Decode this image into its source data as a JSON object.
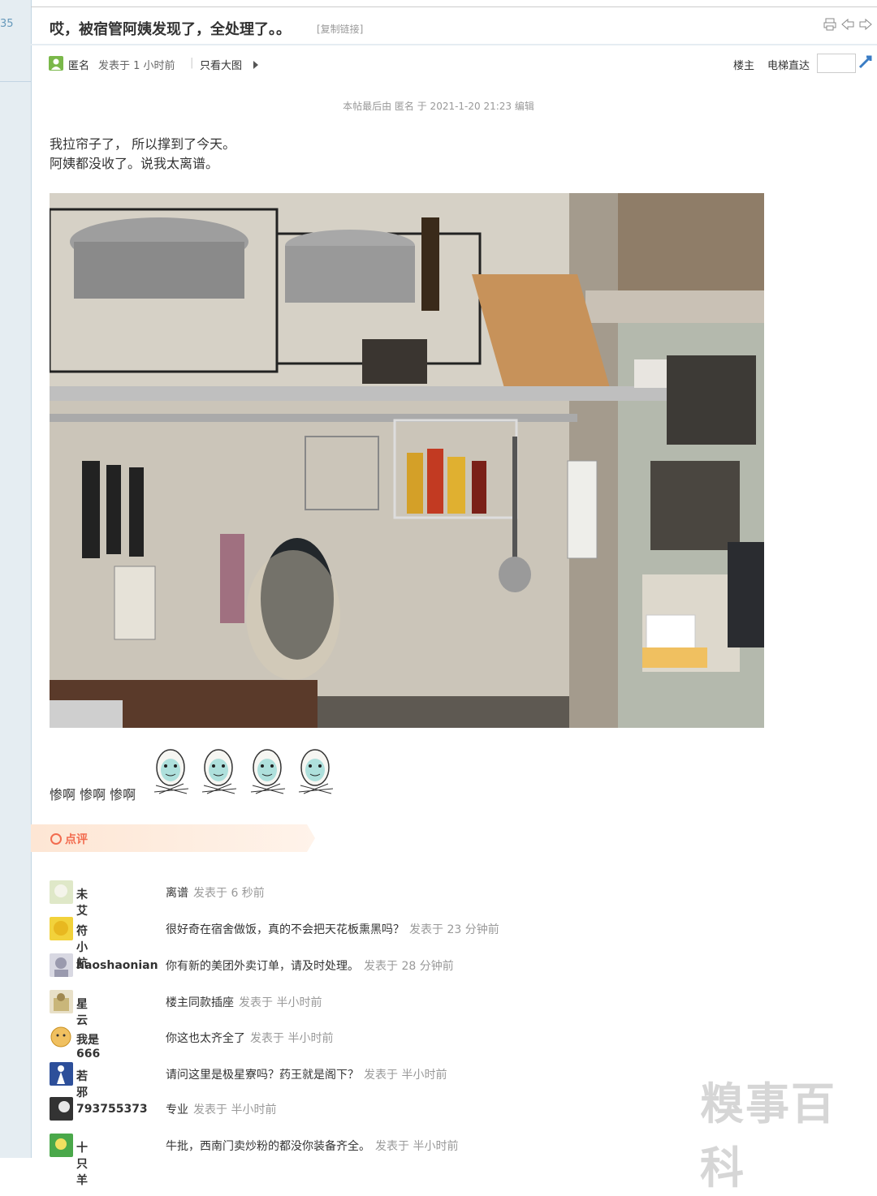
{
  "sidebar": {
    "floor_number": "35"
  },
  "thread": {
    "title": "哎，被宿管阿姨发现了，全处理了。。",
    "copy_link": "[复制链接]"
  },
  "author_bar": {
    "author": "匿名",
    "posted": "发表于 1 小时前",
    "separator": "|",
    "only_pics": "只看大图",
    "op_label": "楼主",
    "jump_label": "电梯直达"
  },
  "post": {
    "edit_note": "本帖最后由 匿名 于 2021-1-20 21:23 编辑",
    "lines": [
      "我拉帘子了， 所以撑到了今天。",
      "阿姨都没收了。说我太离谱。"
    ],
    "cheer": "惨啊 惨啊 惨啊"
  },
  "rating": {
    "label": "点评"
  },
  "comments": [
    {
      "user": "未艾",
      "text": "离谱",
      "time": "发表于 6 秒前",
      "avatar_color": "#dfe8c8"
    },
    {
      "user": "符小航",
      "text": "很好奇在宿舍做饭，真的不会把天花板熏黑吗？",
      "time": "发表于 23 分钟前",
      "avatar_color": "#f2d23b"
    },
    {
      "user": "haoshaonian",
      "text": "你有新的美团外卖订单，请及时处理。",
      "time": "发表于 28 分钟前",
      "avatar_color": "#b8b8c8"
    },
    {
      "user": "星云",
      "text": "楼主同款插座",
      "time": "发表于 半小时前",
      "avatar_color": "#c9b67a"
    },
    {
      "user": "我是666",
      "text": "你这也太齐全了",
      "time": "发表于 半小时前",
      "avatar_color": "#f0c060"
    },
    {
      "user": "若邪",
      "text": "请问这里是极星寮吗？药王就是阁下？",
      "time": "发表于 半小时前",
      "avatar_color": "#2d4f9a"
    },
    {
      "user": "793755373",
      "text": "专业",
      "time": "发表于 半小时前",
      "avatar_color": "#333333"
    },
    {
      "user": "十只羊",
      "text": "牛批，西南门卖炒粉的都没你装备齐全。",
      "time": "发表于 半小时前",
      "avatar_color": "#4aa84a"
    }
  ],
  "watermark": {
    "text": "糗事百科"
  },
  "colors": {
    "accent": "#f26c4f",
    "sidebar_bg": "#e5edf2",
    "muted": "#999999"
  }
}
